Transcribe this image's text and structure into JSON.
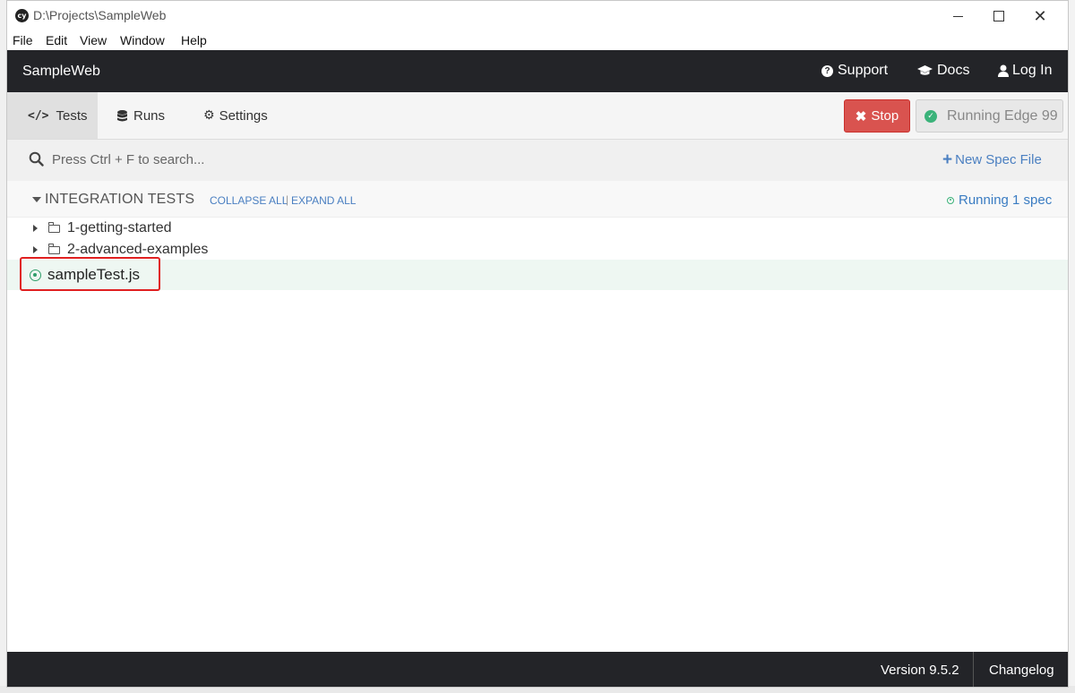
{
  "titlebar": {
    "title": "D:\\Projects\\SampleWeb",
    "app_icon": "cy"
  },
  "menubar": {
    "items": [
      "File",
      "Edit",
      "View",
      "Window",
      "Help"
    ]
  },
  "topnav": {
    "brand": "SampleWeb",
    "links": [
      {
        "label": "Support",
        "icon": "question-circle-icon"
      },
      {
        "label": "Docs",
        "icon": "graduation-cap-icon"
      },
      {
        "label": "Log In",
        "icon": "user-icon"
      }
    ]
  },
  "tabs": {
    "items": [
      {
        "label": "Tests",
        "icon": "code-icon",
        "active": true
      },
      {
        "label": "Runs",
        "icon": "database-icon",
        "active": false
      },
      {
        "label": "Settings",
        "icon": "gear-icon",
        "active": false
      }
    ],
    "stop_label": "Stop",
    "running_label": "Running Edge 99"
  },
  "search": {
    "placeholder": "Press Ctrl + F to search...",
    "new_spec_label": "New Spec File"
  },
  "specs": {
    "section_title": "INTEGRATION TESTS",
    "collapse_all": "COLLAPSE ALL",
    "separator": "|",
    "expand_all": "EXPAND ALL",
    "running_status": "Running 1 spec",
    "folders": [
      "1-getting-started",
      "2-advanced-examples"
    ],
    "active_spec": "sampleTest.js"
  },
  "footer": {
    "version": "Version 9.5.2",
    "changelog": "Changelog"
  },
  "colors": {
    "nav_bg": "#232428",
    "stop_red": "#d9534f",
    "link_blue": "#4a7fc1",
    "running_green": "#3bb37a",
    "highlight_red": "#e02020"
  }
}
